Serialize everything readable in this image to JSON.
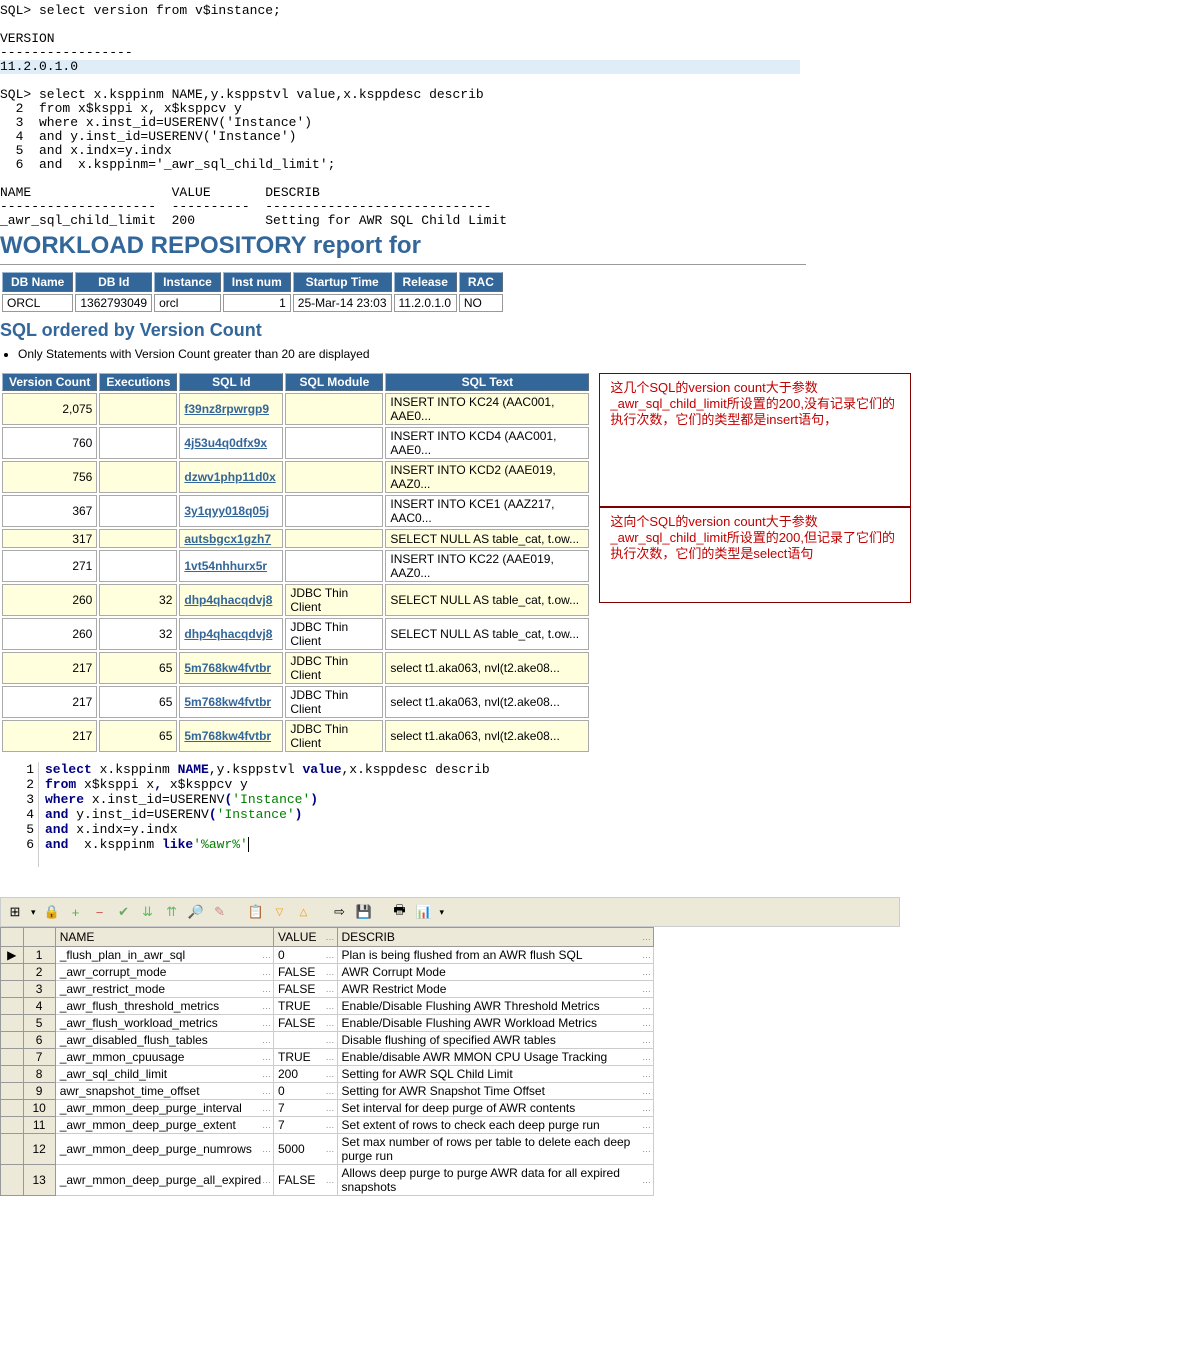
{
  "console": {
    "l1": "SQL> select version from v$instance;",
    "l2": "",
    "l3": "VERSION",
    "l4": "-----------------",
    "l5": "11.2.0.1.0",
    "l6": "",
    "l7": "SQL> select x.ksppinm NAME,y.ksppstvl value,x.ksppdesc describ",
    "l8": "  2  from x$ksppi x, x$ksppcv y",
    "l9": "  3  where x.inst_id=USERENV('Instance')",
    "l10": "  4  and y.inst_id=USERENV('Instance')",
    "l11": "  5  and x.indx=y.indx",
    "l12": "  6  and  x.ksppinm='_awr_sql_child_limit';",
    "l13": "",
    "l14": "NAME                  VALUE       DESCRIB",
    "l15": "--------------------  ----------  -----------------------------",
    "l16": "_awr_sql_child_limit  200         Setting for AWR SQL Child Limit"
  },
  "report_heading": "WORKLOAD REPOSITORY report for",
  "db_table": {
    "headers": [
      "DB Name",
      "DB Id",
      "Instance",
      "Inst num",
      "Startup Time",
      "Release",
      "RAC"
    ],
    "row": [
      "ORCL",
      "1362793049",
      "orcl",
      "1",
      "25-Mar-14 23:03",
      "11.2.0.1.0",
      "NO"
    ]
  },
  "sql_ordered_heading": "SQL ordered by Version Count",
  "bullet": "Only Statements with Version Count greater than 20 are displayed",
  "sqlvers": {
    "headers": [
      "Version Count",
      "Executions",
      "SQL Id",
      "SQL Module",
      "SQL Text"
    ],
    "rows": [
      {
        "vc": "2,075",
        "ex": "",
        "id": "f39nz8rpwrgp9",
        "mod": "",
        "txt": "INSERT INTO KC24 (AAC001, AAE0...",
        "alt": true
      },
      {
        "vc": "760",
        "ex": "",
        "id": "4j53u4q0dfx9x",
        "mod": "",
        "txt": "INSERT INTO KCD4 (AAC001, AAE0..."
      },
      {
        "vc": "756",
        "ex": "",
        "id": "dzwv1php11d0x",
        "mod": "",
        "txt": "INSERT INTO KCD2 (AAE019, AAZ0...",
        "alt": true
      },
      {
        "vc": "367",
        "ex": "",
        "id": "3y1qyy018q05j",
        "mod": "",
        "txt": "INSERT INTO KCE1 (AAZ217, AAC0..."
      },
      {
        "vc": "317",
        "ex": "",
        "id": "autsbgcx1gzh7",
        "mod": "",
        "txt": "SELECT NULL AS table_cat, t.ow...",
        "alt": true
      },
      {
        "vc": "271",
        "ex": "",
        "id": "1vt54nhhurx5r",
        "mod": "",
        "txt": "INSERT INTO KC22 (AAE019, AAZ0..."
      },
      {
        "vc": "260",
        "ex": "32",
        "id": "dhp4qhacqdvj8",
        "mod": "JDBC Thin Client",
        "txt": "SELECT NULL AS table_cat, t.ow...",
        "alt": true
      },
      {
        "vc": "260",
        "ex": "32",
        "id": "dhp4qhacqdvj8",
        "mod": "JDBC Thin Client",
        "txt": "SELECT NULL AS table_cat, t.ow..."
      },
      {
        "vc": "217",
        "ex": "65",
        "id": "5m768kw4fvtbr",
        "mod": "JDBC Thin Client",
        "txt": "select t1.aka063, nvl(t2.ake08...",
        "alt": true
      },
      {
        "vc": "217",
        "ex": "65",
        "id": "5m768kw4fvtbr",
        "mod": "JDBC Thin Client",
        "txt": "select t1.aka063, nvl(t2.ake08..."
      },
      {
        "vc": "217",
        "ex": "65",
        "id": "5m768kw4fvtbr",
        "mod": "JDBC Thin Client",
        "txt": "select t1.aka063, nvl(t2.ake08...",
        "alt": true
      }
    ]
  },
  "anno1": "这几个SQL的version count大于参数_awr_sql_child_limit所设置的200,没有记录它们的执行次数，它们的类型都是insert语句，",
  "anno2": "这向个SQL的version count大于参数_awr_sql_child_limit所设置的200,但记录了它们的执行次数，它们的类型是select语句",
  "editor": {
    "l1": "select x.ksppinm NAME,y.ksppstvl value,x.ksppdesc describ",
    "l2": "from x$ksppi x, x$ksppcv y",
    "l3": "where x.inst_id=USERENV('Instance')",
    "l4": "and y.inst_id=USERENV('Instance')",
    "l5": "and x.indx=y.indx",
    "l6_a": "and  x.ksppinm ",
    "l6_b": "like",
    "l6_c": "'%awr%'"
  },
  "grid": {
    "headers": [
      "",
      "",
      "NAME",
      "VALUE",
      "DESCRIB"
    ],
    "rows": [
      {
        "n": "1",
        "name": "_flush_plan_in_awr_sql",
        "value": "0",
        "desc": "Plan is being flushed from an AWR flush SQL",
        "ind": "▶"
      },
      {
        "n": "2",
        "name": "_awr_corrupt_mode",
        "value": "FALSE",
        "desc": "AWR Corrupt Mode"
      },
      {
        "n": "3",
        "name": "_awr_restrict_mode",
        "value": "FALSE",
        "desc": "AWR Restrict Mode"
      },
      {
        "n": "4",
        "name": "_awr_flush_threshold_metrics",
        "value": "TRUE",
        "desc": "Enable/Disable Flushing AWR Threshold Metrics"
      },
      {
        "n": "5",
        "name": "_awr_flush_workload_metrics",
        "value": "FALSE",
        "desc": "Enable/Disable Flushing AWR Workload Metrics"
      },
      {
        "n": "6",
        "name": "_awr_disabled_flush_tables",
        "value": "",
        "desc": "Disable flushing of specified AWR tables"
      },
      {
        "n": "7",
        "name": "_awr_mmon_cpuusage",
        "value": "TRUE",
        "desc": "Enable/disable AWR MMON CPU Usage Tracking"
      },
      {
        "n": "8",
        "name": "_awr_sql_child_limit",
        "value": "200",
        "desc": "Setting for AWR SQL Child Limit"
      },
      {
        "n": "9",
        "name": "awr_snapshot_time_offset",
        "value": "0",
        "desc": "Setting for AWR Snapshot Time Offset"
      },
      {
        "n": "10",
        "name": "_awr_mmon_deep_purge_interval",
        "value": "7",
        "desc": "Set interval for deep purge of AWR contents"
      },
      {
        "n": "11",
        "name": "_awr_mmon_deep_purge_extent",
        "value": "7",
        "desc": "Set extent of rows to check each deep purge run"
      },
      {
        "n": "12",
        "name": "_awr_mmon_deep_purge_numrows",
        "value": "5000",
        "desc": "Set max number of rows per table to delete each deep purge run"
      },
      {
        "n": "13",
        "name": "_awr_mmon_deep_purge_all_expired",
        "value": "FALSE",
        "desc": "Allows deep purge to purge AWR data for all expired snapshots"
      }
    ]
  },
  "toolbar_icons": [
    "⊞",
    "🖨",
    "+",
    "−",
    "✔",
    "↧",
    "↥",
    "🔍",
    "✎",
    "📋",
    "▽",
    "△",
    "⇢",
    "💾",
    "🖶",
    "📊"
  ]
}
